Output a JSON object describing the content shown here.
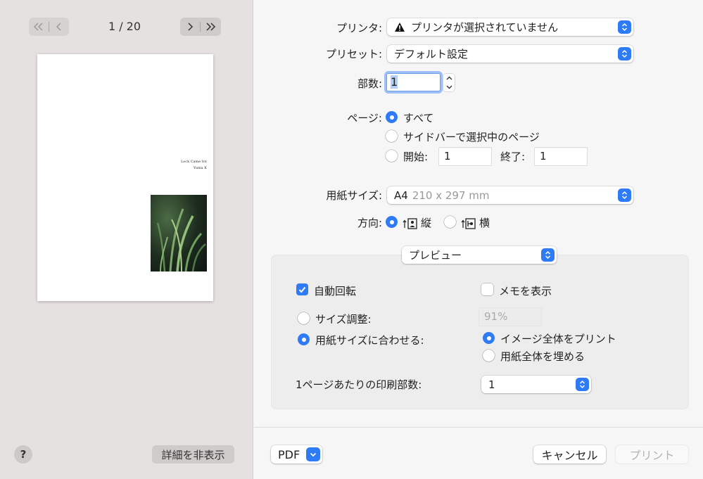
{
  "sidebar": {
    "page_indicator": "1 / 20",
    "preview": {
      "line1": "Lock Came Int",
      "line2": "Yuma K"
    },
    "help_label": "?",
    "hide_details_label": "詳細を非表示"
  },
  "form": {
    "printer_label": "プリンタ:",
    "printer_value": "プリンタが選択されていません",
    "preset_label": "プリセット:",
    "preset_value": "デフォルト設定",
    "copies_label": "部数:",
    "copies_value": "1",
    "pages_label": "ページ:",
    "pages_options": {
      "all": "すべて",
      "sidebar": "サイドバーで選択中のページ",
      "from": "開始:",
      "to": "終了:"
    },
    "pages_from_value": "1",
    "pages_to_value": "1",
    "paper_label": "用紙サイズ:",
    "paper_value": "A4",
    "paper_dims": "210 x 297 mm",
    "orientation_label": "方向:",
    "orientation_portrait": "縦",
    "orientation_landscape": "横"
  },
  "section": {
    "popup_value": "プレビュー",
    "auto_rotate": "自動回転",
    "show_notes": "メモを表示",
    "scale_label": "サイズ調整:",
    "scale_value": "91%",
    "fit_label": "用紙サイズに合わせる:",
    "print_entire": "イメージ全体をプリント",
    "fill_paper": "用紙全体を埋める",
    "pages_per_sheet_label": "1ページあたりの印刷部数:",
    "pages_per_sheet_value": "1"
  },
  "footer": {
    "pdf_label": "PDF",
    "cancel_label": "キャンセル",
    "print_label": "プリント"
  },
  "colors": {
    "accent": "#2f7bf5",
    "sidebar_bg": "#e6e1e1"
  }
}
